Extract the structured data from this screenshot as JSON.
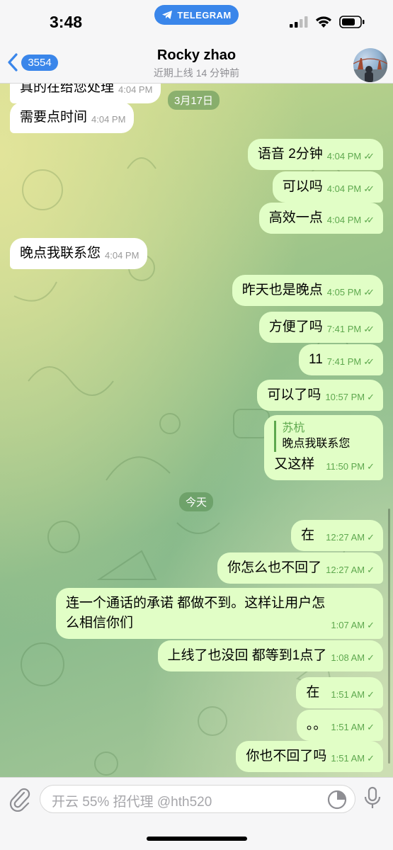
{
  "status_bar": {
    "time": "3:48",
    "banner": "TELEGRAM"
  },
  "header": {
    "back_badge": "3554",
    "title": "Rocky zhao",
    "subtitle": "近期上线 14 分钟前"
  },
  "chat": {
    "partial_top": "真的在给您处理",
    "partial_top_time": "4:04 PM",
    "date_1": "3月17日",
    "date_2": "今天",
    "messages": [
      {
        "dir": "in",
        "text": "需要点时间",
        "time": "4:04 PM",
        "read": false
      },
      {
        "dir": "out",
        "text": "语音 2分钟",
        "time": "4:04 PM",
        "read": true
      },
      {
        "dir": "out",
        "text": "可以吗",
        "time": "4:04 PM",
        "read": true
      },
      {
        "dir": "out",
        "text": "高效一点",
        "time": "4:04 PM",
        "read": true
      },
      {
        "dir": "in",
        "text": "晚点我联系您",
        "time": "4:04 PM",
        "read": false
      },
      {
        "dir": "out",
        "text": "昨天也是晚点",
        "time": "4:05 PM",
        "read": true
      },
      {
        "dir": "out",
        "text": "方便了吗",
        "time": "7:41 PM",
        "read": true
      },
      {
        "dir": "out",
        "text": "11",
        "time": "7:41 PM",
        "read": true
      },
      {
        "dir": "out",
        "text": "可以了吗",
        "time": "10:57 PM",
        "read": false
      },
      {
        "dir": "out",
        "text": "又这样",
        "time": "11:50 PM",
        "read": false,
        "reply_name": "苏杭",
        "reply_text": "晚点我联系您"
      },
      {
        "dir": "out",
        "text": "在",
        "time": "12:27 AM",
        "read": false
      },
      {
        "dir": "out",
        "text": "你怎么也不回了",
        "time": "12:27 AM",
        "read": false
      },
      {
        "dir": "out",
        "text_line1": "连一个通话的承诺 都做不到。这样让用户怎",
        "text_line2": "么相信你们",
        "time": "1:07 AM",
        "read": false
      },
      {
        "dir": "out",
        "text": "上线了也没回 都等到1点了",
        "time": "1:08 AM",
        "read": false
      },
      {
        "dir": "out",
        "text": "在",
        "time": "1:51 AM",
        "read": false
      },
      {
        "dir": "out",
        "text": "。。",
        "time": "1:51 AM",
        "read": false
      },
      {
        "dir": "out",
        "text": "你也不回了吗",
        "time": "1:51 AM",
        "read": false
      }
    ]
  },
  "input": {
    "placeholder": "开云 55% 招代理 @hth520"
  },
  "icons": {
    "attach": "paperclip-icon",
    "sticker": "sticker-icon",
    "mic": "microphone-icon",
    "back": "chevron-left-icon"
  },
  "colors": {
    "accent": "#3a86ea",
    "outgoing_bubble": "#e1fec6",
    "incoming_bubble": "#ffffff",
    "check_green": "#5ea84e"
  }
}
